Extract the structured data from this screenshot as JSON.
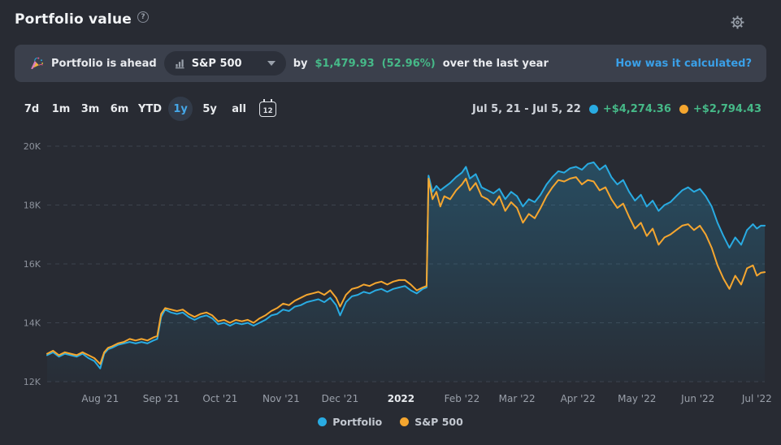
{
  "colors": {
    "page_bg": "#282b33",
    "banner_bg": "#3b404c",
    "pill_bg": "#2c303a",
    "accent_blue": "#29ABE2",
    "accent_orange": "#F5A62F",
    "green": "#46b988",
    "link_blue": "#3aa0e8",
    "grid": "#3d434e",
    "tick_text": "#8d929c",
    "active_range": "#45a7e8"
  },
  "header": {
    "title": "Portfolio value",
    "help_glyph": "?"
  },
  "banner": {
    "text_before": "Portfolio is ahead",
    "benchmark_selector": {
      "icon": "bar-chart",
      "value": "S&P 500"
    },
    "text_by": "by",
    "amount": "$1,479.93",
    "percent": "(52.96%)",
    "text_after": "over the last year",
    "link": "How was it calculated?"
  },
  "controls": {
    "ranges": [
      {
        "label": "7d",
        "active": false
      },
      {
        "label": "1m",
        "active": false
      },
      {
        "label": "3m",
        "active": false
      },
      {
        "label": "6m",
        "active": false
      },
      {
        "label": "YTD",
        "active": false
      },
      {
        "label": "1y",
        "active": true
      },
      {
        "label": "5y",
        "active": false
      },
      {
        "label": "all",
        "active": false
      }
    ],
    "calendar_label": "12",
    "period_summary": {
      "date_range": "Jul 5, 21 - Jul 5, 22",
      "items": [
        {
          "color": "#29ABE2",
          "label": "+$4,274.36"
        },
        {
          "color": "#F5A62F",
          "label": "+$2,794.43"
        }
      ]
    }
  },
  "legend": {
    "items": [
      {
        "color": "#29ABE2",
        "label": "Portfolio"
      },
      {
        "color": "#F5A62F",
        "label": "S&P 500"
      }
    ]
  },
  "chart_data": {
    "type": "line",
    "title": "Portfolio value over the last year",
    "x_unit": "days since Jul 5, 2021",
    "x_range": [
      0,
      365
    ],
    "ylim": [
      12,
      20
    ],
    "y_unit": "USD (thousands)",
    "grid": "dashed horizontal",
    "legend_position": "bottom-center",
    "y_ticks": [
      {
        "label": "20K",
        "value": 20
      },
      {
        "label": "18K",
        "value": 18
      },
      {
        "label": "16K",
        "value": 16
      },
      {
        "label": "14K",
        "value": 14
      },
      {
        "label": "12K",
        "value": 12
      }
    ],
    "x_ticks": [
      {
        "label": "Aug '21",
        "day": 27,
        "bold": false
      },
      {
        "label": "Sep '21",
        "day": 58,
        "bold": false
      },
      {
        "label": "Oct '21",
        "day": 88,
        "bold": false
      },
      {
        "label": "Nov '21",
        "day": 119,
        "bold": false
      },
      {
        "label": "Dec '21",
        "day": 149,
        "bold": false
      },
      {
        "label": "2022",
        "day": 180,
        "bold": true
      },
      {
        "label": "Feb '22",
        "day": 211,
        "bold": false
      },
      {
        "label": "Mar '22",
        "day": 239,
        "bold": false
      },
      {
        "label": "Apr '22",
        "day": 270,
        "bold": false
      },
      {
        "label": "May '22",
        "day": 300,
        "bold": false
      },
      {
        "label": "Jun '22",
        "day": 331,
        "bold": false
      },
      {
        "label": "Jul '22",
        "day": 361,
        "bold": false
      }
    ],
    "series": [
      {
        "name": "Portfolio",
        "color": "#29ABE2",
        "area_fill": true,
        "points": [
          [
            0,
            12.9
          ],
          [
            3,
            13.0
          ],
          [
            6,
            12.85
          ],
          [
            9,
            12.95
          ],
          [
            12,
            12.9
          ],
          [
            15,
            12.85
          ],
          [
            18,
            12.95
          ],
          [
            21,
            12.8
          ],
          [
            24,
            12.7
          ],
          [
            27,
            12.45
          ],
          [
            29,
            12.95
          ],
          [
            31,
            13.1
          ],
          [
            33,
            13.15
          ],
          [
            36,
            13.25
          ],
          [
            39,
            13.3
          ],
          [
            42,
            13.35
          ],
          [
            45,
            13.3
          ],
          [
            48,
            13.35
          ],
          [
            51,
            13.3
          ],
          [
            54,
            13.4
          ],
          [
            56,
            13.45
          ],
          [
            58,
            14.2
          ],
          [
            60,
            14.45
          ],
          [
            63,
            14.35
          ],
          [
            66,
            14.3
          ],
          [
            69,
            14.35
          ],
          [
            72,
            14.2
          ],
          [
            75,
            14.1
          ],
          [
            78,
            14.2
          ],
          [
            81,
            14.25
          ],
          [
            84,
            14.15
          ],
          [
            87,
            13.95
          ],
          [
            90,
            14.0
          ],
          [
            93,
            13.9
          ],
          [
            96,
            14.0
          ],
          [
            99,
            13.95
          ],
          [
            102,
            14.0
          ],
          [
            105,
            13.9
          ],
          [
            108,
            14.0
          ],
          [
            111,
            14.1
          ],
          [
            114,
            14.25
          ],
          [
            117,
            14.3
          ],
          [
            120,
            14.45
          ],
          [
            123,
            14.4
          ],
          [
            126,
            14.55
          ],
          [
            129,
            14.6
          ],
          [
            132,
            14.7
          ],
          [
            135,
            14.75
          ],
          [
            138,
            14.8
          ],
          [
            141,
            14.7
          ],
          [
            144,
            14.85
          ],
          [
            147,
            14.6
          ],
          [
            149,
            14.25
          ],
          [
            152,
            14.7
          ],
          [
            155,
            14.9
          ],
          [
            158,
            14.95
          ],
          [
            161,
            15.05
          ],
          [
            164,
            15.0
          ],
          [
            167,
            15.1
          ],
          [
            170,
            15.15
          ],
          [
            173,
            15.05
          ],
          [
            176,
            15.15
          ],
          [
            179,
            15.2
          ],
          [
            182,
            15.25
          ],
          [
            185,
            15.1
          ],
          [
            188,
            15.0
          ],
          [
            191,
            15.15
          ],
          [
            193,
            15.2
          ],
          [
            194,
            19.0
          ],
          [
            196,
            18.45
          ],
          [
            198,
            18.65
          ],
          [
            200,
            18.5
          ],
          [
            202,
            18.6
          ],
          [
            205,
            18.75
          ],
          [
            208,
            18.95
          ],
          [
            211,
            19.1
          ],
          [
            213,
            19.3
          ],
          [
            215,
            18.9
          ],
          [
            218,
            19.05
          ],
          [
            221,
            18.6
          ],
          [
            224,
            18.5
          ],
          [
            227,
            18.4
          ],
          [
            230,
            18.55
          ],
          [
            233,
            18.2
          ],
          [
            236,
            18.45
          ],
          [
            239,
            18.3
          ],
          [
            242,
            17.95
          ],
          [
            245,
            18.2
          ],
          [
            248,
            18.1
          ],
          [
            251,
            18.35
          ],
          [
            254,
            18.7
          ],
          [
            257,
            18.95
          ],
          [
            260,
            19.15
          ],
          [
            263,
            19.1
          ],
          [
            266,
            19.25
          ],
          [
            269,
            19.3
          ],
          [
            272,
            19.2
          ],
          [
            275,
            19.4
          ],
          [
            278,
            19.45
          ],
          [
            281,
            19.2
          ],
          [
            284,
            19.35
          ],
          [
            287,
            18.95
          ],
          [
            290,
            18.7
          ],
          [
            293,
            18.85
          ],
          [
            296,
            18.45
          ],
          [
            299,
            18.15
          ],
          [
            302,
            18.35
          ],
          [
            305,
            17.95
          ],
          [
            308,
            18.15
          ],
          [
            311,
            17.8
          ],
          [
            314,
            18.0
          ],
          [
            317,
            18.1
          ],
          [
            320,
            18.3
          ],
          [
            323,
            18.5
          ],
          [
            326,
            18.6
          ],
          [
            329,
            18.45
          ],
          [
            332,
            18.55
          ],
          [
            335,
            18.3
          ],
          [
            338,
            17.95
          ],
          [
            341,
            17.4
          ],
          [
            344,
            16.95
          ],
          [
            347,
            16.55
          ],
          [
            350,
            16.9
          ],
          [
            353,
            16.65
          ],
          [
            356,
            17.15
          ],
          [
            359,
            17.35
          ],
          [
            361,
            17.2
          ],
          [
            363,
            17.3
          ],
          [
            365,
            17.3
          ]
        ]
      },
      {
        "name": "S&P 500",
        "color": "#F5A62F",
        "area_fill": false,
        "points": [
          [
            0,
            12.95
          ],
          [
            3,
            13.05
          ],
          [
            6,
            12.9
          ],
          [
            9,
            13.0
          ],
          [
            12,
            12.95
          ],
          [
            15,
            12.9
          ],
          [
            18,
            13.0
          ],
          [
            21,
            12.9
          ],
          [
            24,
            12.8
          ],
          [
            27,
            12.6
          ],
          [
            29,
            13.0
          ],
          [
            31,
            13.15
          ],
          [
            33,
            13.2
          ],
          [
            36,
            13.3
          ],
          [
            39,
            13.35
          ],
          [
            42,
            13.45
          ],
          [
            45,
            13.4
          ],
          [
            48,
            13.45
          ],
          [
            51,
            13.4
          ],
          [
            54,
            13.5
          ],
          [
            56,
            13.55
          ],
          [
            58,
            14.3
          ],
          [
            60,
            14.5
          ],
          [
            63,
            14.45
          ],
          [
            66,
            14.4
          ],
          [
            69,
            14.45
          ],
          [
            72,
            14.3
          ],
          [
            75,
            14.2
          ],
          [
            78,
            14.3
          ],
          [
            81,
            14.35
          ],
          [
            84,
            14.25
          ],
          [
            87,
            14.05
          ],
          [
            90,
            14.1
          ],
          [
            93,
            14.0
          ],
          [
            96,
            14.1
          ],
          [
            99,
            14.05
          ],
          [
            102,
            14.1
          ],
          [
            105,
            14.0
          ],
          [
            108,
            14.15
          ],
          [
            111,
            14.25
          ],
          [
            114,
            14.4
          ],
          [
            117,
            14.5
          ],
          [
            120,
            14.65
          ],
          [
            123,
            14.6
          ],
          [
            126,
            14.75
          ],
          [
            129,
            14.85
          ],
          [
            132,
            14.95
          ],
          [
            135,
            15.0
          ],
          [
            138,
            15.05
          ],
          [
            141,
            14.95
          ],
          [
            144,
            15.1
          ],
          [
            147,
            14.85
          ],
          [
            149,
            14.55
          ],
          [
            152,
            14.95
          ],
          [
            155,
            15.15
          ],
          [
            158,
            15.2
          ],
          [
            161,
            15.3
          ],
          [
            164,
            15.25
          ],
          [
            167,
            15.35
          ],
          [
            170,
            15.4
          ],
          [
            173,
            15.3
          ],
          [
            176,
            15.4
          ],
          [
            179,
            15.45
          ],
          [
            182,
            15.45
          ],
          [
            185,
            15.3
          ],
          [
            188,
            15.1
          ],
          [
            191,
            15.2
          ],
          [
            193,
            15.25
          ],
          [
            194,
            18.9
          ],
          [
            196,
            18.2
          ],
          [
            198,
            18.45
          ],
          [
            200,
            17.95
          ],
          [
            202,
            18.3
          ],
          [
            205,
            18.2
          ],
          [
            208,
            18.5
          ],
          [
            211,
            18.7
          ],
          [
            213,
            18.9
          ],
          [
            215,
            18.5
          ],
          [
            218,
            18.75
          ],
          [
            221,
            18.3
          ],
          [
            224,
            18.2
          ],
          [
            227,
            18.0
          ],
          [
            230,
            18.3
          ],
          [
            233,
            17.8
          ],
          [
            236,
            18.1
          ],
          [
            239,
            17.9
          ],
          [
            242,
            17.4
          ],
          [
            245,
            17.7
          ],
          [
            248,
            17.55
          ],
          [
            251,
            17.9
          ],
          [
            254,
            18.3
          ],
          [
            257,
            18.6
          ],
          [
            260,
            18.85
          ],
          [
            263,
            18.8
          ],
          [
            266,
            18.9
          ],
          [
            269,
            18.95
          ],
          [
            272,
            18.7
          ],
          [
            275,
            18.85
          ],
          [
            278,
            18.8
          ],
          [
            281,
            18.5
          ],
          [
            284,
            18.6
          ],
          [
            287,
            18.2
          ],
          [
            290,
            17.9
          ],
          [
            293,
            18.05
          ],
          [
            296,
            17.6
          ],
          [
            299,
            17.2
          ],
          [
            302,
            17.4
          ],
          [
            305,
            16.95
          ],
          [
            308,
            17.2
          ],
          [
            311,
            16.65
          ],
          [
            314,
            16.9
          ],
          [
            317,
            17.0
          ],
          [
            320,
            17.15
          ],
          [
            323,
            17.3
          ],
          [
            326,
            17.35
          ],
          [
            329,
            17.15
          ],
          [
            332,
            17.3
          ],
          [
            335,
            17.0
          ],
          [
            338,
            16.55
          ],
          [
            341,
            15.95
          ],
          [
            344,
            15.5
          ],
          [
            347,
            15.15
          ],
          [
            350,
            15.6
          ],
          [
            353,
            15.3
          ],
          [
            356,
            15.85
          ],
          [
            359,
            15.95
          ],
          [
            361,
            15.6
          ],
          [
            363,
            15.7
          ],
          [
            365,
            15.72
          ]
        ]
      }
    ]
  }
}
